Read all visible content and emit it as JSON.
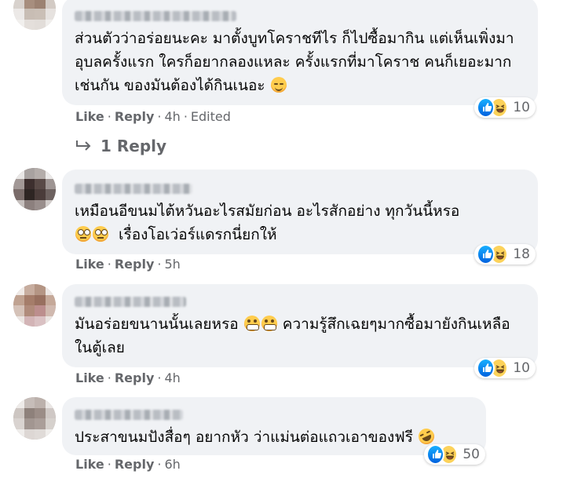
{
  "colors": {
    "bubble": "#f0f2f5",
    "text": "#050505",
    "secondary": "#65676b",
    "like_blue": "#0062df",
    "haha_yellow": "#fcd25a"
  },
  "comments": [
    {
      "text": "ส่วนตัวว่าอร่อยนะคะ มาตั้งบูทโคราชทีไร ก็ไปซื้อมากิน แต่เห็นเพิ่งมาอุบลครั้งแรก ใครก็อยากลองแหละ ครั้งแรกที่มาโคราช คนก็เยอะมากเช่นกัน ของมันต้องได้กินเนอะ",
      "emoji": "smiling-face-icon",
      "reaction_count": "10",
      "like_label": "Like",
      "reply_label": "Reply",
      "time": "4h",
      "edited": "Edited"
    },
    {
      "text": "เหมือนอีขนมไต้หวันอะไรสมัยก่อน อะไรสักอย่าง ทุกวันนี้หรอ",
      "text2": "เรื่องโอเว่อร์แดรกนี่ยกให้",
      "emoji": "face-with-rolling-eyes-icon",
      "reaction_count": "18",
      "like_label": "Like",
      "reply_label": "Reply",
      "time": "5h"
    },
    {
      "text": "มันอร่อยขนานนั้นเลยหรอ",
      "text2": "ความรู้สึกเฉยๆมากซื้อมายังกินเหลือในตู้เลย",
      "emoji": "grimacing-face-icon",
      "reaction_count": "10",
      "like_label": "Like",
      "reply_label": "Reply",
      "time": "4h"
    },
    {
      "text": "ประสาขนมปังสื่อๆ อยากหัว ว่าแม่นต่อแถวเอาของฟรี",
      "emoji": "rolling-on-floor-laughing-icon",
      "reaction_count": "50",
      "like_label": "Like",
      "reply_label": "Reply",
      "time": "6h"
    }
  ],
  "replies": {
    "label": "1 Reply"
  }
}
